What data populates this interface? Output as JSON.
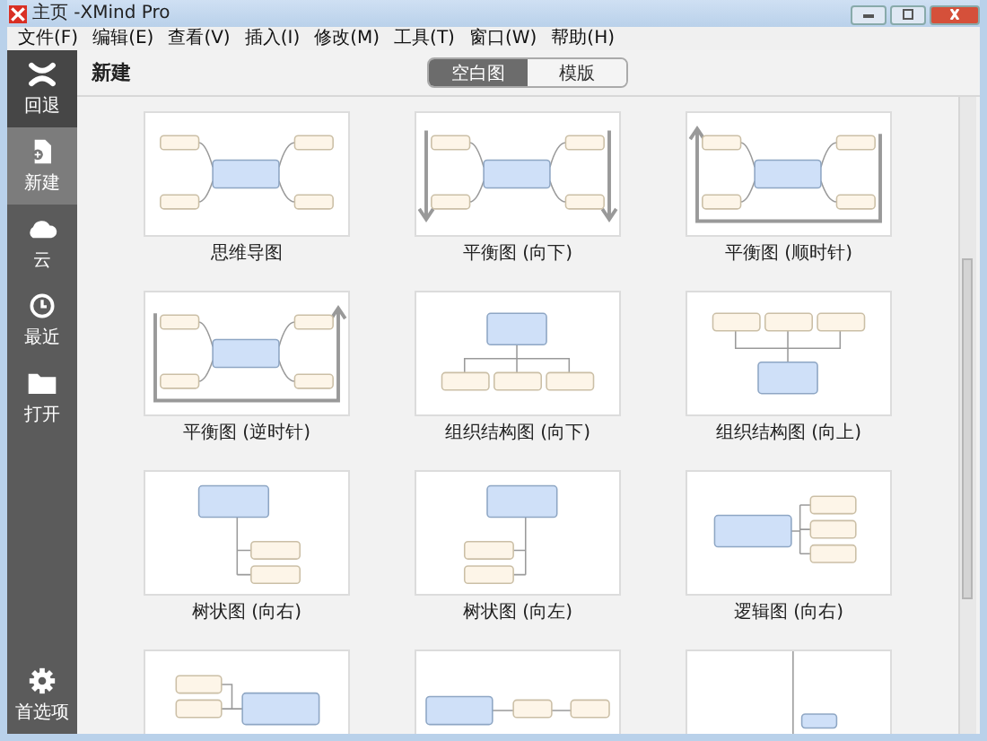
{
  "window": {
    "title": "主页 -XMind Pro"
  },
  "menu": [
    "文件(F)",
    "编辑(E)",
    "查看(V)",
    "插入(I)",
    "修改(M)",
    "工具(T)",
    "窗口(W)",
    "帮助(H)"
  ],
  "sidebar": {
    "items": [
      {
        "kind": "back",
        "label": "回退",
        "selected": false
      },
      {
        "kind": "new",
        "label": "新建",
        "selected": true
      },
      {
        "kind": "cloud",
        "label": "云",
        "selected": false
      },
      {
        "kind": "recent",
        "label": "最近",
        "selected": false
      },
      {
        "kind": "open",
        "label": "打开",
        "selected": false
      }
    ],
    "footer": {
      "kind": "settings",
      "label": "首选项"
    }
  },
  "header": {
    "title": "新建",
    "tabs": [
      {
        "label": "空白图",
        "selected": true
      },
      {
        "label": "模版",
        "selected": false
      }
    ]
  },
  "templates": [
    {
      "kind": "mindmap",
      "label": "思维导图"
    },
    {
      "kind": "balance-down",
      "label": "平衡图 (向下)"
    },
    {
      "kind": "balance-cw",
      "label": "平衡图 (顺时针)"
    },
    {
      "kind": "balance-ccw",
      "label": "平衡图 (逆时针)"
    },
    {
      "kind": "org-down",
      "label": "组织结构图 (向下)"
    },
    {
      "kind": "org-up",
      "label": "组织结构图 (向上)"
    },
    {
      "kind": "tree-right",
      "label": "树状图 (向右)"
    },
    {
      "kind": "tree-left",
      "label": "树状图 (向左)"
    },
    {
      "kind": "logic-right",
      "label": "逻辑图 (向右)"
    },
    {
      "kind": "logic-left"
    },
    {
      "kind": "timeline"
    },
    {
      "kind": "split"
    }
  ]
}
